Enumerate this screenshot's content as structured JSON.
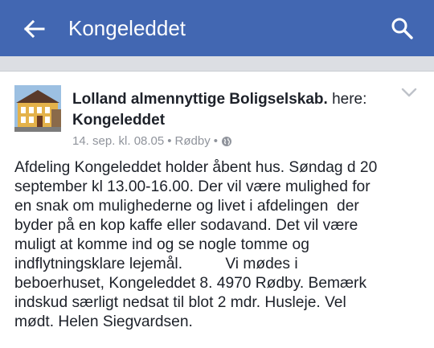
{
  "appbar": {
    "title": "Kongeleddet",
    "bg_color": "#4267b2",
    "back_icon": "arrow-left-icon",
    "search_icon": "search-icon"
  },
  "post": {
    "author": "Lolland almennyttige Boligselskab.",
    "connector": "here:",
    "location_page": "Kongeleddet",
    "timestamp": "14. sep. kl. 08.05",
    "place": "Rødby",
    "separator": "•",
    "privacy_icon": "globe-icon",
    "menu_icon": "chevron-down-icon",
    "body_lines": [
      "Afdeling Kongeleddet holder åbent hus. Søndag d 20",
      "september kl 13.00-16.00. Der vil være mulighed for",
      "en snak om mulighederne og livet i afdelingen  der",
      "byder på en kop kaffe eller sodavand. Det vil være",
      "muligt at komme ind og se nogle tomme og",
      "indflytningsklare lejemål.          Vi mødes i",
      "beboerhuset, Kongeleddet 8. 4970 Rødby. Bemærk",
      "indskud særligt nedsat til blot 2 mdr. Husleje. Vel",
      "mødt. Helen Siegvardsen."
    ]
  }
}
